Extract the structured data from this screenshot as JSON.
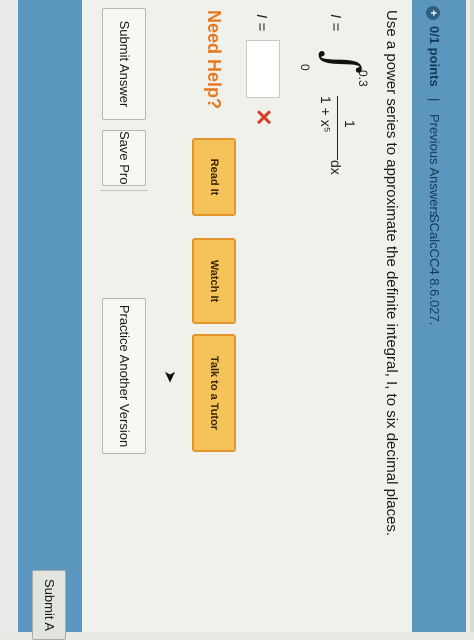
{
  "header": {
    "points_icon": "plus-circle-icon",
    "points": "0/1 points",
    "separator": "|",
    "previous_answers": "Previous Answers",
    "problem_code": "SCalcCC4 8.6.027."
  },
  "question": {
    "text": "Use a power series to approximate the definite integral, I, to six decimal places.",
    "integral": {
      "variable": "I =",
      "sign": "∫",
      "upper_limit": "0.3",
      "lower_limit": "0",
      "numerator": "1",
      "denominator": "1 + x⁵",
      "differential": "dx"
    }
  },
  "answer": {
    "label": "I =",
    "value": "",
    "status_icon": "x-mark-icon",
    "status_glyph": "✕",
    "status_color": "#d83b2b"
  },
  "help": {
    "label": "Need Help?",
    "buttons": [
      "Read It",
      "Watch It",
      "Talk to a Tutor"
    ],
    "color": "#e8781f"
  },
  "actions": {
    "submit": "Submit Answer",
    "save": "Save Progress",
    "practice": "Practice Another Version"
  },
  "footer": {
    "submit": "Submit A"
  },
  "colors": {
    "header_bar": "#5b96bf",
    "help_button": "#f6c35b"
  }
}
